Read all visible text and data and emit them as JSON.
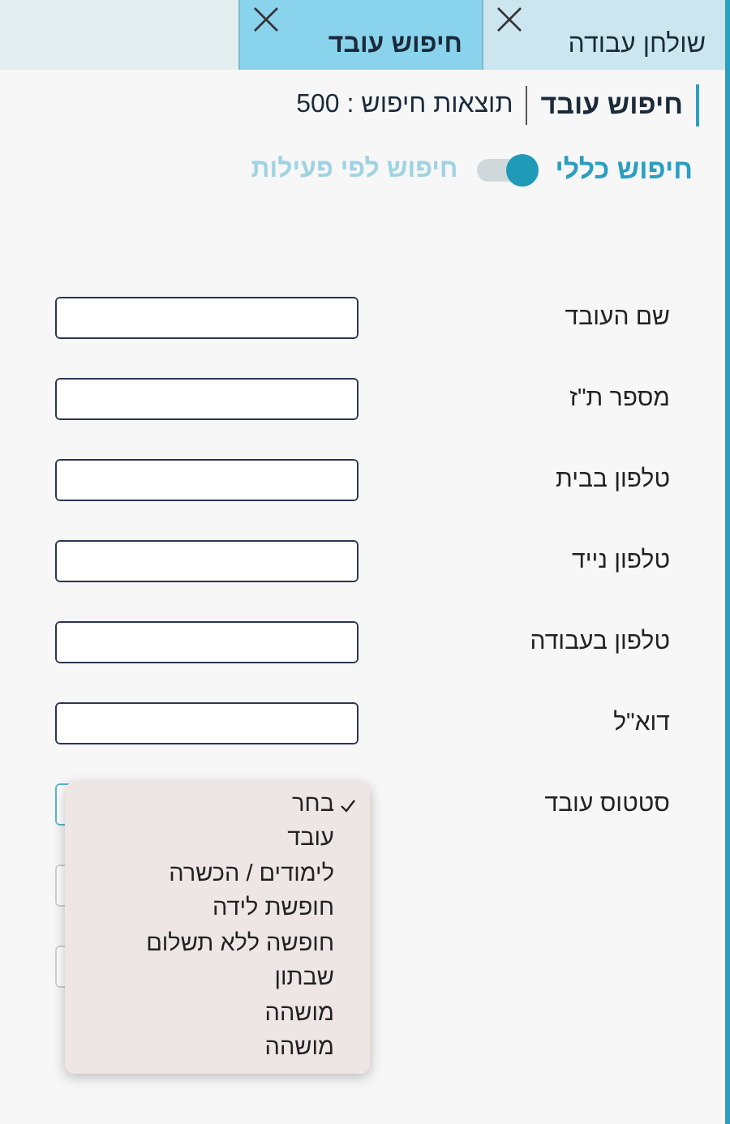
{
  "tabs": [
    {
      "label": "שולחן עבודה",
      "selected": false
    },
    {
      "label": "חיפוש עובד",
      "selected": true
    }
  ],
  "header": {
    "title": "חיפוש עובד",
    "results": "תוצאות חיפוש : 500"
  },
  "search_mode": {
    "general_label": "חיפוש כללי",
    "activity_label": "חיפוש לפי פעילות",
    "on": true
  },
  "fields": [
    {
      "label": "שם העובד"
    },
    {
      "label": "מספר ת\"ז"
    },
    {
      "label": "טלפון בבית"
    },
    {
      "label": "טלפון נייד"
    },
    {
      "label": "טלפון בעבודה"
    },
    {
      "label": "דוא\"ל"
    }
  ],
  "status_field": {
    "label": "סטטוס עובד",
    "expanded": true,
    "options": [
      {
        "label": "בחר",
        "selected": true
      },
      {
        "label": "עובד",
        "selected": false
      },
      {
        "label": "לימודים / הכשרה",
        "selected": false
      },
      {
        "label": "חופשת לידה",
        "selected": false
      },
      {
        "label": "חופשה ללא תשלום",
        "selected": false
      },
      {
        "label": "שבתון",
        "selected": false
      },
      {
        "label": "מושהה",
        "selected": false
      },
      {
        "label": "מושהה",
        "selected": false
      }
    ]
  }
}
